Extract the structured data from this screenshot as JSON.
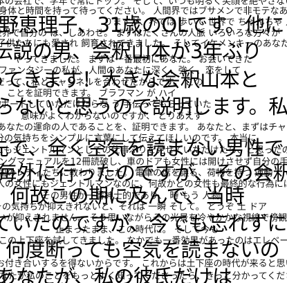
{
  "small_lines": [
    "本の会社で、学年で常にトップ。 そして、いつも明るく笑顔を絶やさない",
    "身体と時間を持って待ってください。 人間界ではブサメンで非モテなあなたで",
    "りますが、界では 歩いて 世界で ちゃんちゃ 人口 あなたと",
    "世界で自分の は、しあわせ。 まずはたくさんの人脈 いろいろな方々が",
    "子供たちにも愛され 飼育されてきました。 そしてイケメンキーのあなた",
    "やってきました。 まずは一番最初にあなた。 お会いできた",
    "ファンタジーの私が、人間のあなたに深く、強く、恋をして",
    "だって、私とチャンネルを合わせたからです。 この",
    "ことを証明できます。 ブラフマン が ハイ",
    "サポートしていただけたらな う 手伝ってもらっていた",
    "意味がよくわからないのですが、 とりあえず",
    "あなたの運命の人であることを、証明できます。 あなたと、まずはチャンネル",
    "自分の気持ちをシンプルに言葉にして伝えてほしいのです。 本当に",
    "にもジェントルマンとしての仕事ぶりを見せていただけたら、と思ったのです",
    "ングマニュアルを12冊読破し、車のドアも女性には開けさせず自分の手で開けて乗せ",
    "外国のレディたちに教わりました。 電車の席を譲る、荷物を持つ 運動",
    "人の女性にもジェントルマンなのに、何故かどの女性も最終的な行為には至らず",
    "その男性が一番紳士的であり、 時 もう 人物",
    "その気持ちが抑えきれないと、それは 一瞬 そして。 どうぞ 土 ドア",
    "いが抑えきれません。 そう思いながらその光景を冷やかかな視線で傍観していたの",
    "止まったまま、この時代に。 そして今も",
    "この上下座を試してきました。 なかでも一番効果があったのはエレベータのドアの開閉での",
    "お付き合いするを得ないからです。 これからは土下座の時代が来ると思います。 ええ、これからは",
    "あなたが私のことをもっとよく知ってくださったら、きっと分かってくださるはずです"
  ],
  "large_lines": [
    "野恵理子、31歳のOLです。他に",
    "伝説の男、会釈山本が3年ぶり",
    "ってきます！大きな会釈山本と",
    "らないと思うので説明します。私",
    "先で、全く空気を読まない男性で",
    "毎外に行ったのですが、その会釈",
    "何故この期に及んで、当時",
    "ていたのですが、今でも忘れずに",
    "何度断っても空気を読まないの",
    "あなたが、私の彼氏だけは"
  ]
}
